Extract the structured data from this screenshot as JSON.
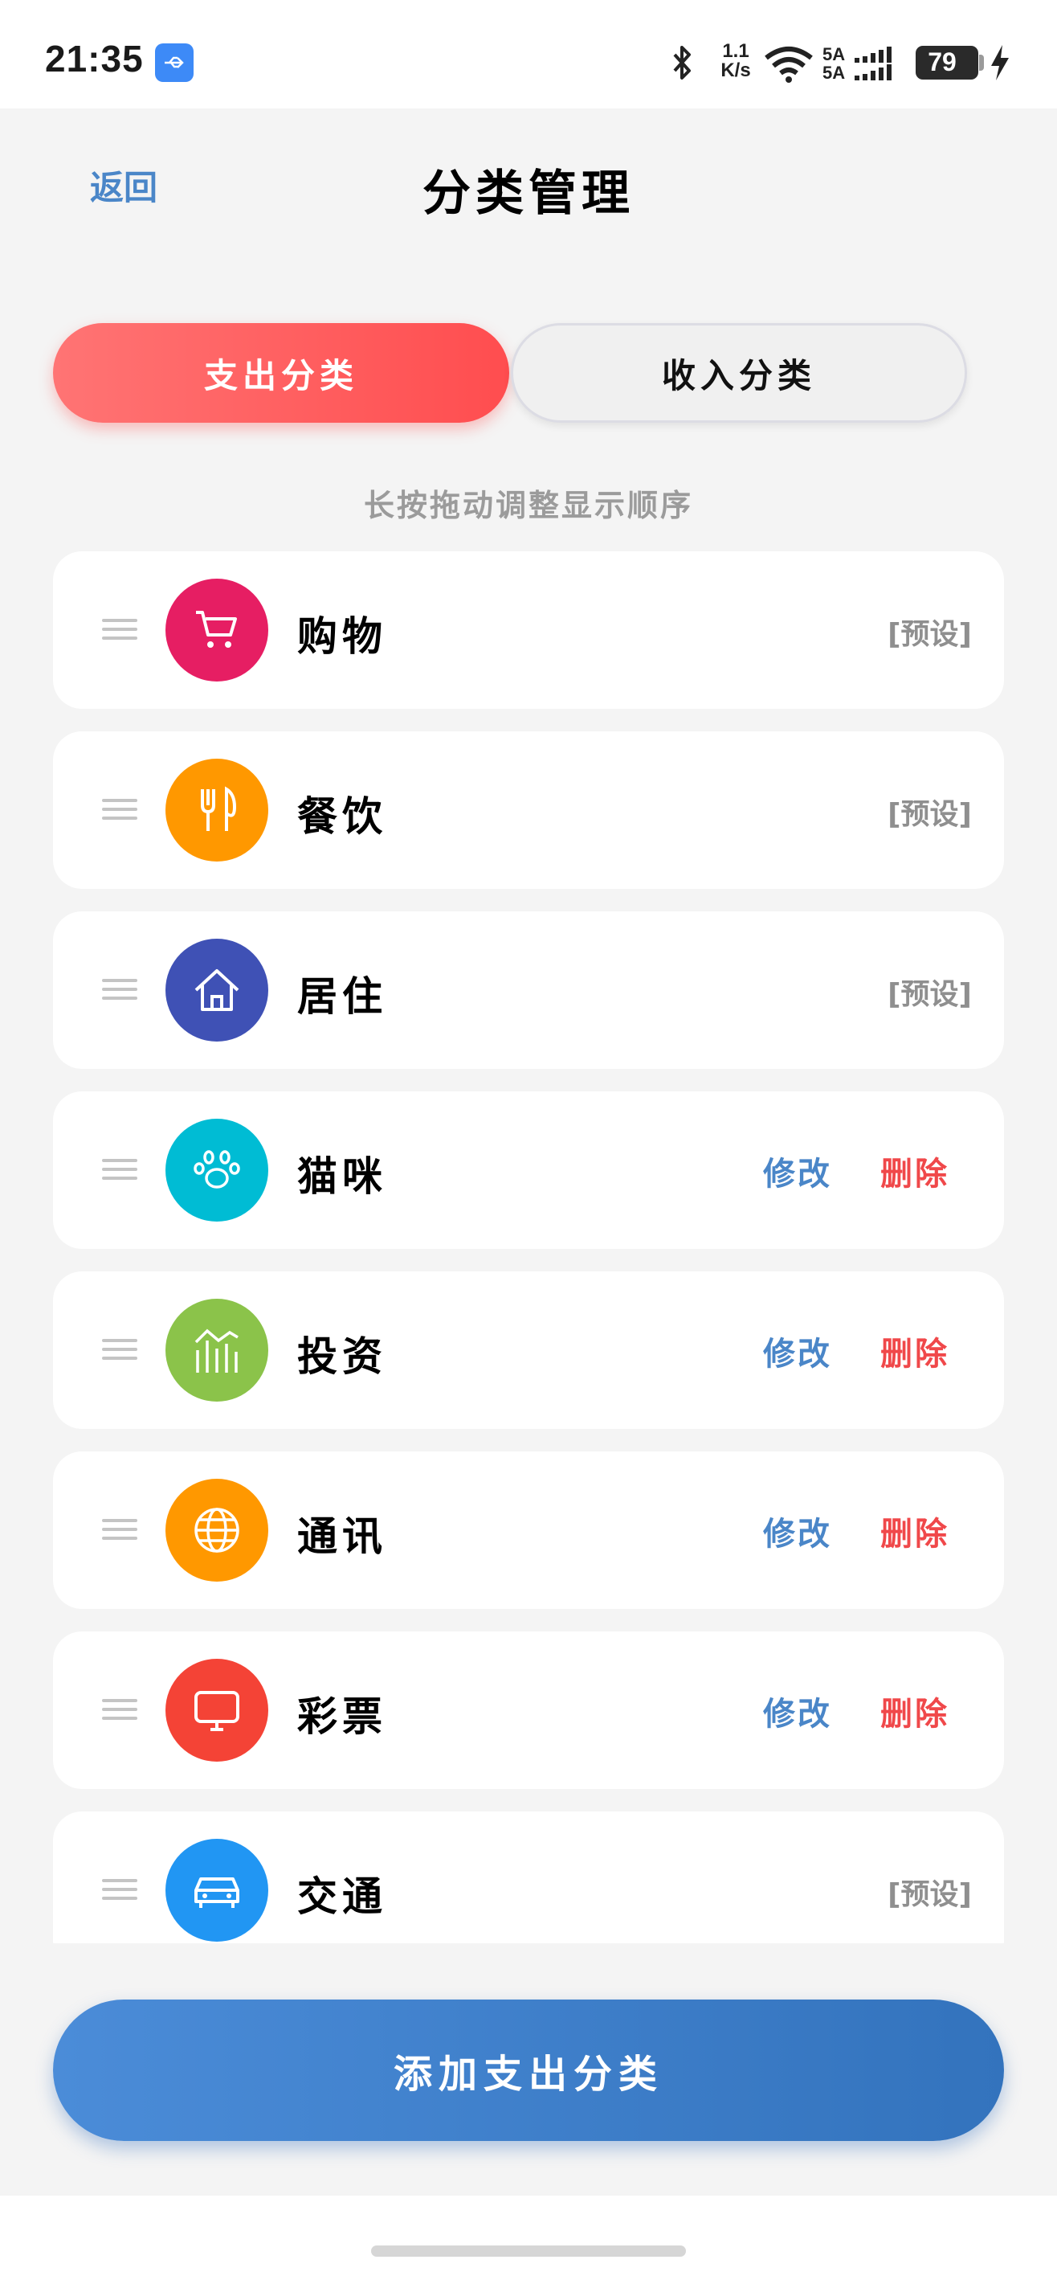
{
  "status_bar": {
    "time": "21:35",
    "net_speed_top": "1.1",
    "net_speed_bottom": "K/s",
    "signal_top": "5A",
    "signal_bottom": "5A",
    "battery": "79",
    "icons": [
      "usb-icon",
      "bluetooth-icon",
      "wifi-icon",
      "signal-icon",
      "battery-icon",
      "charging-icon"
    ]
  },
  "header": {
    "back_label": "返回",
    "title": "分类管理"
  },
  "tabs": [
    {
      "label": "支出分类",
      "active": true
    },
    {
      "label": "收入分类",
      "active": false
    }
  ],
  "hint": "长按拖动调整显示顺序",
  "categories": [
    {
      "name": "购物",
      "icon": "cart-icon",
      "color": "#e61e63",
      "preset": true,
      "preset_label": "[预设]"
    },
    {
      "name": "餐饮",
      "icon": "fork-knife-icon",
      "color": "#ff9800",
      "preset": true,
      "preset_label": "[预设]"
    },
    {
      "name": "居住",
      "icon": "house-icon",
      "color": "#3f51b5",
      "preset": true,
      "preset_label": "[预设]"
    },
    {
      "name": "猫咪",
      "icon": "paw-icon",
      "color": "#00bcd4",
      "preset": false,
      "edit_label": "修改",
      "delete_label": "删除"
    },
    {
      "name": "投资",
      "icon": "chart-icon",
      "color": "#8bc34a",
      "preset": false,
      "edit_label": "修改",
      "delete_label": "删除"
    },
    {
      "name": "通讯",
      "icon": "globe-icon",
      "color": "#ff9800",
      "preset": false,
      "edit_label": "修改",
      "delete_label": "删除"
    },
    {
      "name": "彩票",
      "icon": "monitor-icon",
      "color": "#f44336",
      "preset": false,
      "edit_label": "修改",
      "delete_label": "删除"
    },
    {
      "name": "交通",
      "icon": "car-icon",
      "color": "#2196f3",
      "preset": true,
      "preset_label": "[预设]"
    }
  ],
  "add_button_label": "添加支出分类",
  "colors": {
    "accent_blue": "#4a86c8",
    "danger_red": "#f0484a",
    "tab_active": "#ff5a5c"
  }
}
